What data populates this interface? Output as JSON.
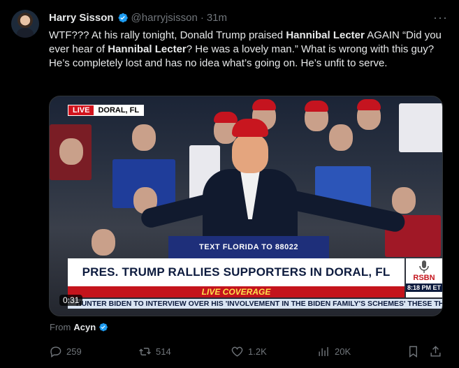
{
  "author": {
    "name": "Harry Sisson",
    "handle": "@harryjsisson",
    "separator": "·",
    "time": "31m",
    "more": "···"
  },
  "tweet": {
    "p1": "WTF??? At his rally tonight, Donald Trump praised ",
    "b1": "Hannibal Lecter",
    "p2": " AGAIN “Did you ever hear of ",
    "b2": "Hannibal Lecter",
    "p3": "? He was a lovely man.” What is wrong with this guy? He’s completely lost and has no idea what’s going on. He’s unfit to serve."
  },
  "video": {
    "live_label": "LIVE",
    "location": "DORAL, FL",
    "podium_text": "TEXT FLORIDA TO 88022",
    "headline": "PRES. TRUMP RALLIES SUPPORTERS IN DORAL, FL",
    "live_coverage": "LIVE COVERAGE",
    "network": "RSBN",
    "network_time": "8:18 PM ET",
    "ticker": "HUNTER BIDEN TO INTERVIEW OVER HIS 'INVOLVEMENT IN THE BIDEN FAMILY'S SCHEMES'   THESE THRE",
    "duration": "0:31"
  },
  "source": {
    "prefix": "From",
    "name": "Acyn"
  },
  "actions": {
    "replies": "259",
    "reposts": "514",
    "likes": "1.2K",
    "views": "20K"
  },
  "colors": {
    "verified": "#1d9bf0",
    "muted": "#71767b",
    "text": "#e7e9ea",
    "live_red": "#d2141d"
  }
}
